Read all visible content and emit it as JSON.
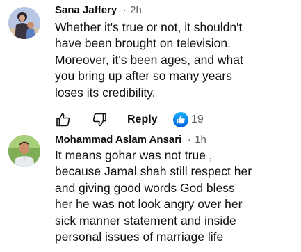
{
  "comments": [
    {
      "author": "Sana Jaffery",
      "separator": "·",
      "time": "2h",
      "lines": [
        "Whether it's true or not, it shouldn't",
        "have been brought on television.",
        "Moreover, it's been ages, and what",
        "you bring up after so many years",
        "loses its credibility."
      ],
      "actions": {
        "like_icon": "thumbs-up-outline-icon",
        "dislike_icon": "thumbs-down-outline-icon",
        "reply_label": "Reply",
        "reaction_icon": "like-reaction-icon",
        "reaction_count": "19"
      }
    },
    {
      "author": "Mohammad Aslam Ansari",
      "separator": "·",
      "time": "1h",
      "lines": [
        "It means gohar was not true ,",
        "because Jamal shah still respect her",
        "and giving good words God bless",
        "her he was not look angry over her",
        "sick manner statement and inside",
        "personal issues of marriage life"
      ]
    }
  ],
  "colors": {
    "text": "#0f0f0f",
    "secondary_text": "#606060",
    "reaction_blue": "#0866ff"
  }
}
